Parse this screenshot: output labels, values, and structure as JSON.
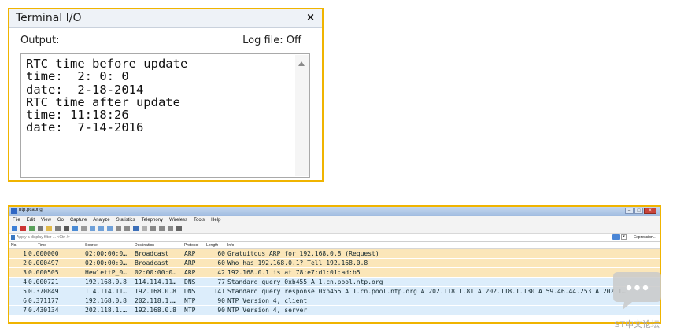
{
  "terminal": {
    "title": "Terminal I/O",
    "close_glyph": "×",
    "output_label": "Output:",
    "logfile_label": "Log file: Off",
    "lines": [
      "RTC time before update",
      "time:  2: 0: 0",
      "date:  2-18-2014",
      "RTC time after update",
      "time: 11:18:26",
      "date:  7-14-2016"
    ]
  },
  "wireshark": {
    "title": "ntp.pcapng",
    "menu": [
      "File",
      "Edit",
      "View",
      "Go",
      "Capture",
      "Analyze",
      "Statistics",
      "Telephony",
      "Wireless",
      "Tools",
      "Help"
    ],
    "toolbar_icons": [
      "shark-fin-start-icon",
      "stop-icon",
      "restart-icon",
      "options-gear-icon",
      "open-file-icon",
      "save-file-icon",
      "close-file-icon",
      "reload-icon",
      "find-icon",
      "back-icon",
      "forward-icon",
      "jump-icon",
      "top-icon",
      "bottom-icon",
      "autoscroll-icon",
      "colorize-icon",
      "zoom-in-icon",
      "zoom-out-icon",
      "zoom-normal-icon",
      "resize-columns-icon"
    ],
    "filter_placeholder": "Apply a display filter ... <Ctrl-/>",
    "expression_label": "Expression...",
    "columns": {
      "no": "No.",
      "time": "Time",
      "source": "Source",
      "destination": "Destination",
      "protocol": "Protocol",
      "length": "Length",
      "info": "Info"
    },
    "rows": [
      {
        "no": "1",
        "time": "0.000000",
        "source": "02:00:00:0…",
        "destination": "Broadcast",
        "protocol": "ARP",
        "length": "60",
        "info": "Gratuitous ARP for 192.168.0.8 (Request)",
        "color": "#fbe6b9"
      },
      {
        "no": "2",
        "time": "0.000497",
        "source": "02:00:00:0…",
        "destination": "Broadcast",
        "protocol": "ARP",
        "length": "60",
        "info": "Who has 192.168.0.1? Tell 192.168.0.8",
        "color": "#fbe6b9"
      },
      {
        "no": "3",
        "time": "0.000505",
        "source": "HewlettP_0…",
        "destination": "02:00:00:0…",
        "protocol": "ARP",
        "length": "42",
        "info": "192.168.0.1 is at 78:e7:d1:01:ad:b5",
        "color": "#fbe6b9"
      },
      {
        "no": "4",
        "time": "0.000721",
        "source": "192.168.0.8",
        "destination": "114.114.11…",
        "protocol": "DNS",
        "length": "77",
        "info": "Standard query 0xb455 A 1.cn.pool.ntp.org",
        "color": "#dcedfb"
      },
      {
        "no": "5",
        "time": "0.370849",
        "source": "114.114.11…",
        "destination": "192.168.0.8",
        "protocol": "DNS",
        "length": "141",
        "info": "Standard query response 0xb455 A 1.cn.pool.ntp.org A 202.118.1.81 A 202.118.1.130 A 59.46.44.253 A 202.1…",
        "color": "#dcedfb"
      },
      {
        "no": "6",
        "time": "0.371177",
        "source": "192.168.0.8",
        "destination": "202.118.1.…",
        "protocol": "NTP",
        "length": "90",
        "info": "NTP Version 4, client",
        "color": "#dcedfb"
      },
      {
        "no": "7",
        "time": "0.430134",
        "source": "202.118.1.…",
        "destination": "192.168.0.8",
        "protocol": "NTP",
        "length": "90",
        "info": "NTP Version 4, server",
        "color": "#dcedfb"
      }
    ]
  },
  "watermark": {
    "text": "ST中文论坛",
    "color": "#a8a8a8"
  },
  "colors": {
    "highlight_border": "#f0b400",
    "arp_row": "#fbe6b9",
    "udp_row": "#dcedfb"
  }
}
